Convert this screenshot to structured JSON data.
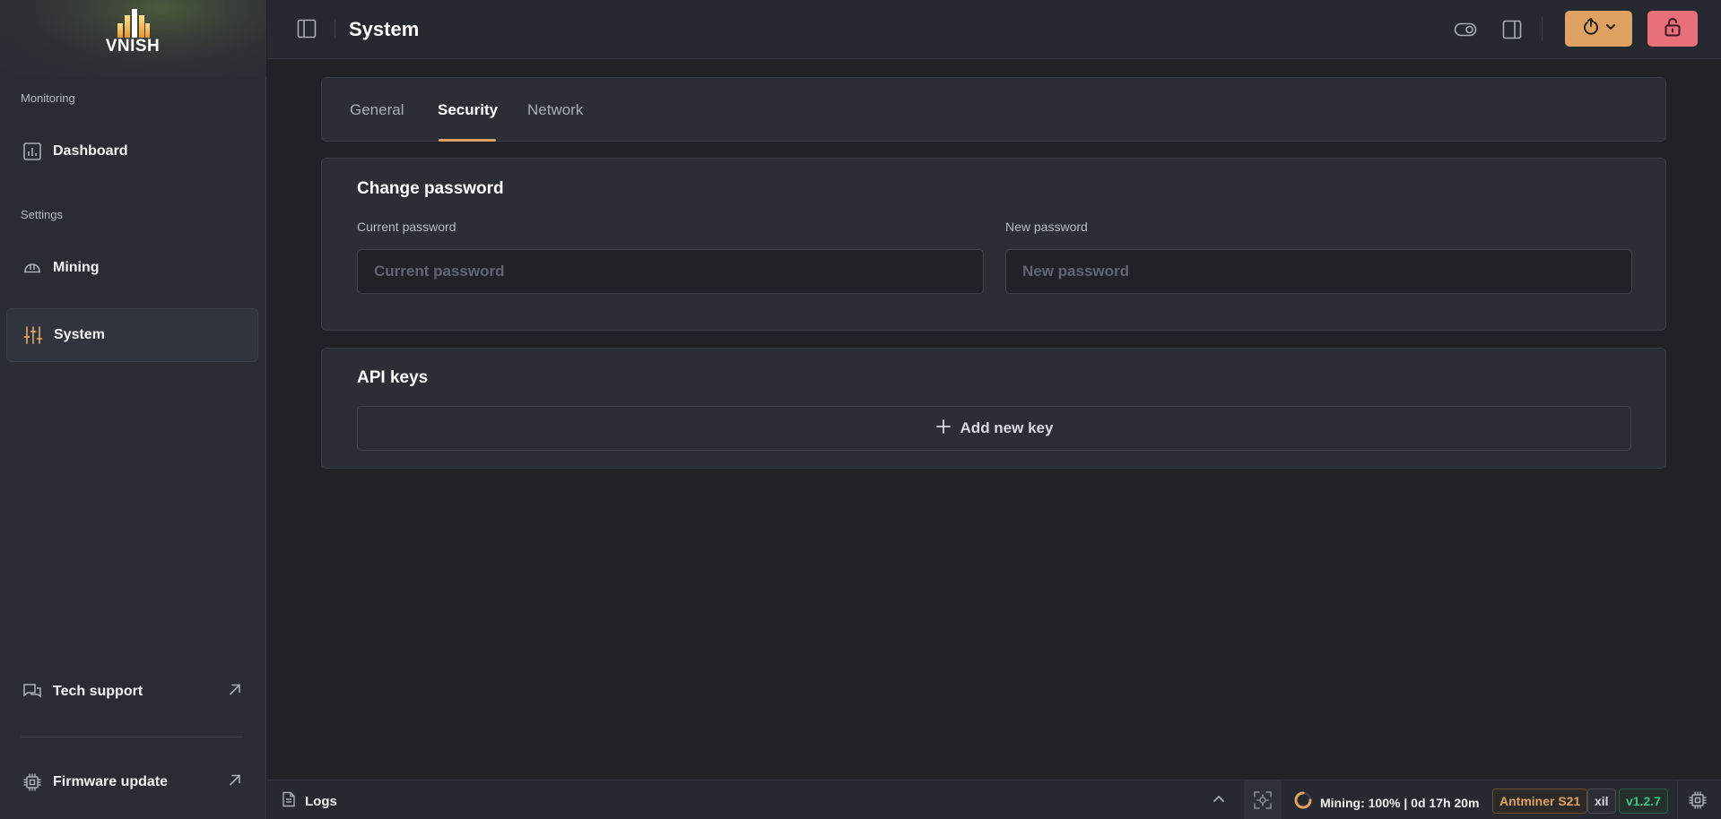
{
  "brand": {
    "name": "VNISH"
  },
  "sidebar": {
    "sections": [
      {
        "label": "Monitoring",
        "items": [
          {
            "label": "Dashboard",
            "icon": "bar-chart-icon"
          }
        ]
      },
      {
        "label": "Settings",
        "items": [
          {
            "label": "Mining",
            "icon": "hardhat-icon"
          },
          {
            "label": "System",
            "icon": "sliders-icon",
            "active": true
          }
        ]
      }
    ],
    "footer": [
      {
        "label": "Tech support",
        "icon": "chat-icon"
      },
      {
        "label": "Firmware update",
        "icon": "chip-icon"
      }
    ]
  },
  "header": {
    "title": "System"
  },
  "tabs": [
    {
      "label": "General"
    },
    {
      "label": "Security",
      "active": true
    },
    {
      "label": "Network"
    }
  ],
  "password": {
    "title": "Change password",
    "current_label": "Current password",
    "current_placeholder": "Current password",
    "new_label": "New password",
    "new_placeholder": "New password"
  },
  "api_keys": {
    "title": "API keys",
    "add_label": "Add new key"
  },
  "statusbar": {
    "logs_label": "Logs",
    "mining_status": "Mining: 100% | 0d 17h 20m",
    "model": "Antminer S21",
    "user": "xil",
    "version": "v1.2.7"
  },
  "colors": {
    "accent": "#e0a262",
    "danger": "#e8707a",
    "success": "#3ec48a",
    "background": "#202227",
    "card": "#2b2e35"
  }
}
